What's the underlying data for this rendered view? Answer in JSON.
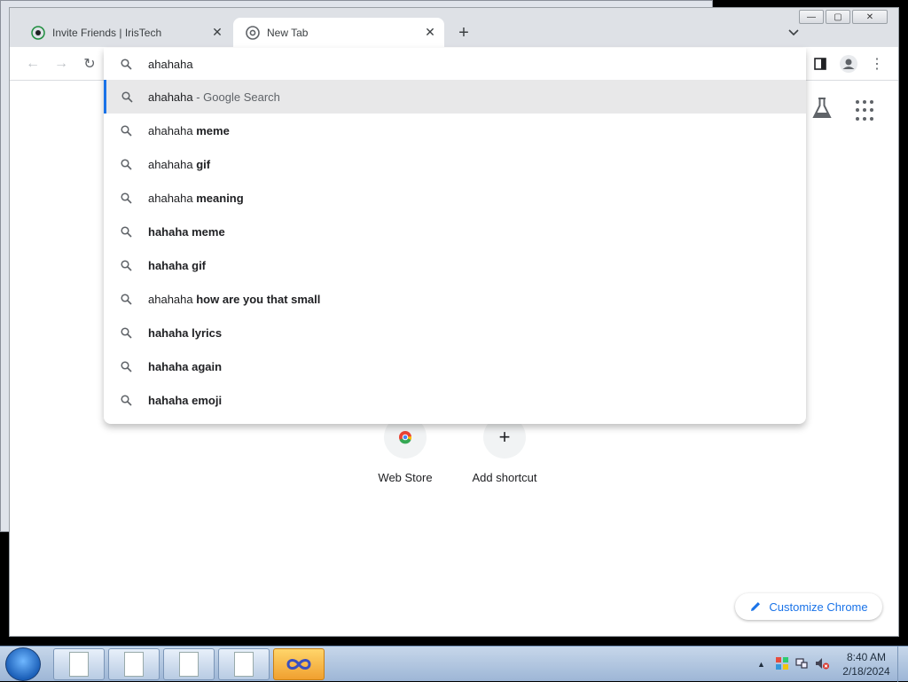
{
  "browser": {
    "tabs": [
      {
        "title": "Invite Friends | IrisTech",
        "active": false
      },
      {
        "title": "New Tab",
        "active": true
      }
    ]
  },
  "omnibox": {
    "input_value": "ahahaha",
    "suggestions": [
      {
        "plain": "ahahaha",
        "bold": "",
        "suffix": " - Google Search",
        "selected": true
      },
      {
        "plain": "ahahaha ",
        "bold": "meme"
      },
      {
        "plain": "ahahaha ",
        "bold": "gif"
      },
      {
        "plain": "ahahaha ",
        "bold": "meaning"
      },
      {
        "plain": "",
        "bold": "hahaha meme"
      },
      {
        "plain": "",
        "bold": "hahaha gif"
      },
      {
        "plain": "ahahaha ",
        "bold": "how are you that small"
      },
      {
        "plain": "",
        "bold": "hahaha lyrics"
      },
      {
        "plain": "",
        "bold": "hahaha again"
      },
      {
        "plain": "",
        "bold": "hahaha emoji"
      }
    ]
  },
  "newtab": {
    "shortcuts": [
      {
        "label": "Web Store",
        "icon": "chrome-webstore-icon"
      },
      {
        "label": "Add shortcut",
        "icon": "plus-icon"
      }
    ],
    "customize_label": "Customize Chrome"
  },
  "taskbar": {
    "time": "8:40 AM",
    "date": "2/18/2024"
  },
  "colors": {
    "accent": "#1a73e8",
    "tab_strip": "#dee1e6"
  }
}
